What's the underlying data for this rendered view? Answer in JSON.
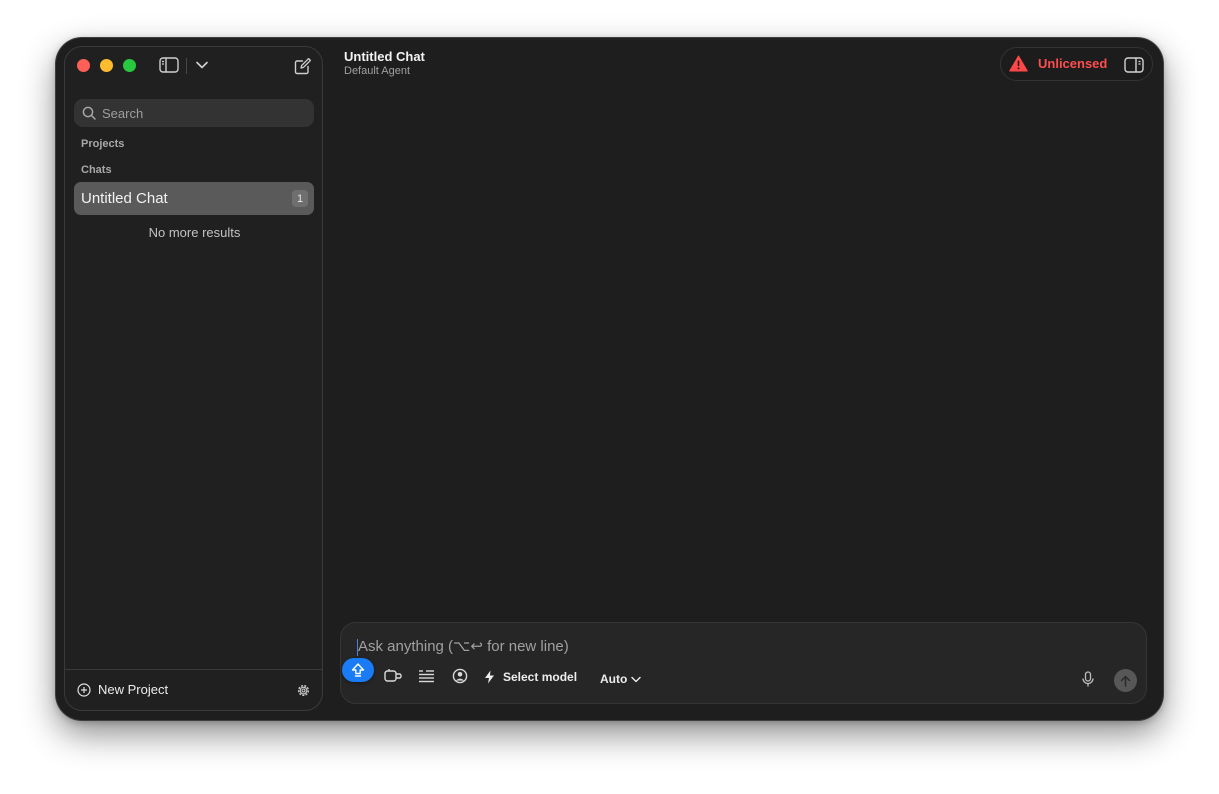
{
  "sidebar": {
    "search": {
      "placeholder": "Search"
    },
    "sections": {
      "projects": "Projects",
      "chats": "Chats"
    },
    "chats": [
      {
        "title": "Untitled Chat",
        "count": "1"
      }
    ],
    "empty_text": "No more results",
    "footer": {
      "new_project_label": "New Project"
    }
  },
  "header": {
    "title": "Untitled Chat",
    "subtitle": "Default Agent",
    "license_status": "Unlicensed"
  },
  "composer": {
    "placeholder": "Ask anything (⌥↩ for new line)",
    "model_label": "Select model",
    "mode_label": "Auto"
  },
  "colors": {
    "window_bg": "#1e1e1e",
    "sidebar_bg": "#202020",
    "accent_blue": "#1a7cf5",
    "warning_red": "#ff4d4d",
    "selected_item": "#5a5a5a"
  },
  "icons": [
    "sidebar-toggle-icon",
    "chevron-down-icon",
    "compose-icon",
    "search-icon",
    "plus-circle-icon",
    "gear-icon",
    "warning-icon",
    "right-panel-icon",
    "tool-icon",
    "list-icon",
    "person-icon",
    "bolt-icon",
    "microphone-icon",
    "arrow-up-icon",
    "shift-icon"
  ]
}
